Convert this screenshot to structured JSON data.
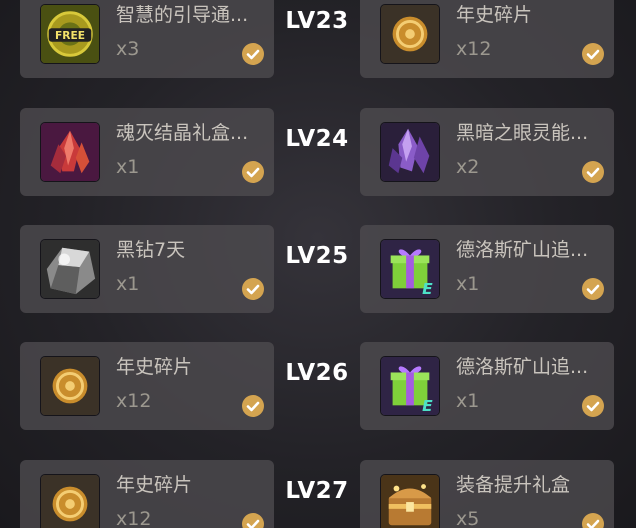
{
  "rows": [
    {
      "level": "LV23",
      "left": {
        "name": "智慧的引导通...",
        "qty": "x3",
        "icon": "free-gear-icon",
        "claimed": true
      },
      "right": {
        "name": "年史碎片",
        "qty": "x12",
        "icon": "coin-icon",
        "claimed": true
      }
    },
    {
      "level": "LV24",
      "left": {
        "name": "魂灭结晶礼盒...",
        "qty": "x1",
        "icon": "red-crystal-icon",
        "claimed": true
      },
      "right": {
        "name": "黑暗之眼灵能...",
        "qty": "x2",
        "icon": "purple-crystal-icon",
        "claimed": true
      }
    },
    {
      "level": "LV25",
      "left": {
        "name": "黑钻7天",
        "qty": "x1",
        "icon": "black-diamond-icon",
        "claimed": true
      },
      "right": {
        "name": "德洛斯矿山追...",
        "qty": "x1",
        "icon": "gift-box-icon",
        "claimed": true
      }
    },
    {
      "level": "LV26",
      "left": {
        "name": "年史碎片",
        "qty": "x12",
        "icon": "coin-icon",
        "claimed": true
      },
      "right": {
        "name": "德洛斯矿山追...",
        "qty": "x1",
        "icon": "gift-box-icon",
        "claimed": true
      }
    },
    {
      "level": "LV27",
      "left": {
        "name": "年史碎片",
        "qty": "x12",
        "icon": "coin-icon",
        "claimed": true
      },
      "right": {
        "name": "装备提升礼盒",
        "qty": "x5",
        "icon": "treasure-chest-icon",
        "claimed": true
      }
    }
  ],
  "icon_text": {
    "free": "FREE",
    "e_badge": "E"
  }
}
